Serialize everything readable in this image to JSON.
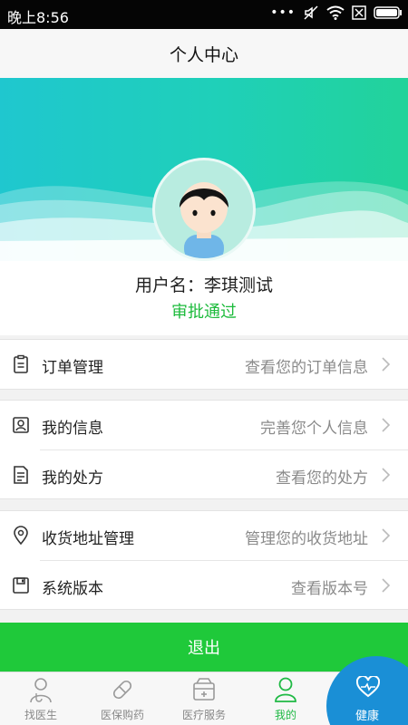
{
  "status_bar": {
    "time": "晚上8:56"
  },
  "header": {
    "title": "个人中心"
  },
  "profile": {
    "username_label": "用户名：李琪测试",
    "approval_status": "审批通过"
  },
  "menu": {
    "orders": {
      "label": "订单管理",
      "value": "查看您的订单信息"
    },
    "my_info": {
      "label": "我的信息",
      "value": "完善您个人信息"
    },
    "my_prescription": {
      "label": "我的处方",
      "value": "查看您的处方"
    },
    "address": {
      "label": "收货地址管理",
      "value": "管理您的收货地址"
    },
    "version": {
      "label": "系统版本",
      "value": "查看版本号"
    }
  },
  "logout_label": "退出",
  "tabs": [
    {
      "label": "找医生",
      "icon": "doctor-icon"
    },
    {
      "label": "医保购药",
      "icon": "pill-icon"
    },
    {
      "label": "医疗服务",
      "icon": "service-icon"
    },
    {
      "label": "我的",
      "icon": "user-icon",
      "active": true
    },
    {
      "label": "健康",
      "icon": "heart-icon"
    }
  ],
  "colors": {
    "accent_green": "#1fc93a",
    "banner_start": "#1fc7cf",
    "banner_end": "#22d39a",
    "health_blue": "#1a8fd6"
  }
}
